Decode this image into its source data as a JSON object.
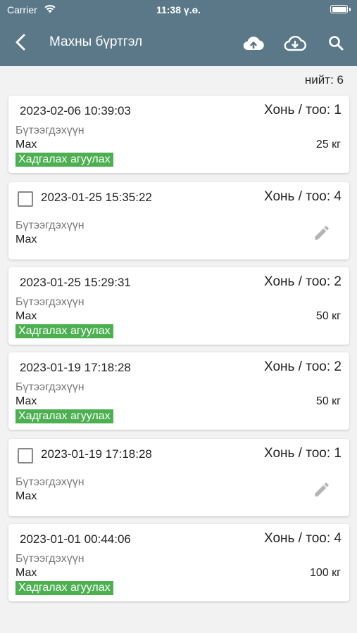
{
  "status_bar": {
    "carrier": "Carrier",
    "time": "11:38 ү.ө."
  },
  "header": {
    "title": "Махны бүртгэл"
  },
  "summary": {
    "total": "нийт: 6"
  },
  "cards": [
    {
      "date": "2023-02-06 10:39:03",
      "type": "Хонь / тоо: 1",
      "label": "Бүтээгдэхүүн",
      "product": "Мах",
      "weight": "25 кг",
      "badge": "Хадгалах агуулах"
    },
    {
      "date": "2023-01-25 15:35:22",
      "type": "Хонь / тоо: 4",
      "label": "Бүтээгдэхүүн",
      "product": "Мах"
    },
    {
      "date": "2023-01-25 15:29:31",
      "type": "Хонь / тоо: 2",
      "label": "Бүтээгдэхүүн",
      "product": "Мах",
      "weight": "50 кг",
      "badge": "Хадгалах агуулах"
    },
    {
      "date": "2023-01-19 17:18:28",
      "type": "Хонь / тоо: 2",
      "label": "Бүтээгдэхүүн",
      "product": "Мах",
      "weight": "50 кг",
      "badge": "Хадгалах агуулах"
    },
    {
      "date": "2023-01-19 17:18:28",
      "type": "Хонь / тоо: 1",
      "label": "Бүтээгдэхүүн",
      "product": "Мах"
    },
    {
      "date": "2023-01-01 00:44:06",
      "type": "Хонь / тоо: 4",
      "label": "Бүтээгдэхүүн",
      "product": "Мах",
      "weight": "100 кг",
      "badge": "Хадгалах агуулах"
    }
  ],
  "theme": {
    "header_bg": "#5b7889",
    "badge_bg": "#4caf50",
    "page_bg": "#f2f2f2"
  }
}
